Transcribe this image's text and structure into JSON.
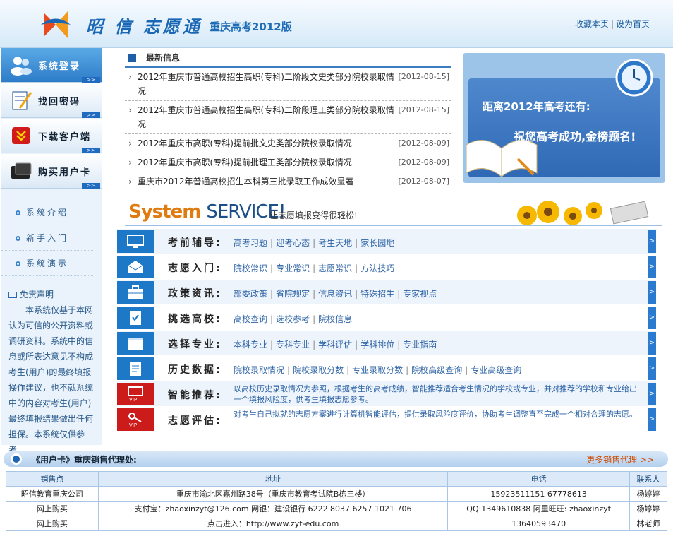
{
  "header": {
    "brand": "昭 信 志愿通",
    "edition": "重庆高考2012版",
    "links": [
      "收藏本页",
      "设为首页"
    ]
  },
  "sidebar": {
    "buttons": [
      {
        "label": "系统登录",
        "icon": "users-icon"
      },
      {
        "label": "找回密码",
        "icon": "notepad-icon"
      },
      {
        "label": "下载客户端",
        "icon": "download-icon"
      },
      {
        "label": "购买用户卡",
        "icon": "card-icon"
      }
    ],
    "subnav": [
      "系统介绍",
      "新手入门",
      "系统演示"
    ],
    "disclaimer_title": "免责声明",
    "disclaimer_text": "本系统仅基于本网认为可信的公开资料或调研资料。系统中的信息或所表达意见不构成考生(用户)的最终填报操作建议，也不就系统中的内容对考生(用户)最终填报结果做出任何担保。本系统仅供参考。"
  },
  "news": {
    "title": "最新信息",
    "items": [
      {
        "text": "2012年重庆市普通高校招生高职(专科)二阶段文史类部分院校录取情况",
        "date": "[2012-08-15]"
      },
      {
        "text": "2012年重庆市普通高校招生高职(专科)二阶段理工类部分院校录取情况",
        "date": "[2012-08-15]"
      },
      {
        "text": "2012年重庆市高职(专科)提前批文史类部分院校录取情况",
        "date": "[2012-08-09]"
      },
      {
        "text": "2012年重庆市高职(专科)提前批理工类部分院校录取情况",
        "date": "[2012-08-09]"
      },
      {
        "text": "重庆市2012年普通高校招生本科第三批录取工作成效显著",
        "date": "[2012-08-07]"
      }
    ]
  },
  "countdown": {
    "line1": "距离2012年高考还有:",
    "line2": "祝您高考成功,金榜题名!"
  },
  "service": {
    "big1": "System",
    "big2": "SERVICE!",
    "subtitle": "让志愿填报变得很轻松!"
  },
  "rows": [
    {
      "name": "考前辅导:",
      "links": [
        "高考习题",
        "迎考心态",
        "考生天地",
        "家长园地"
      ],
      "tile": "blue",
      "icon": "monitor-icon"
    },
    {
      "name": "志愿入门:",
      "links": [
        "院校常识",
        "专业常识",
        "志愿常识",
        "方法技巧"
      ],
      "tile": "blue",
      "icon": "envelope-icon"
    },
    {
      "name": "政策资讯:",
      "links": [
        "部委政策",
        "省院规定",
        "信息资讯",
        "特殊招生",
        "专家视点"
      ],
      "tile": "blue",
      "icon": "briefcase-icon"
    },
    {
      "name": "挑选高校:",
      "links": [
        "高校查询",
        "选校参考",
        "院校信息"
      ],
      "tile": "blue",
      "icon": "clipboard-icon"
    },
    {
      "name": "选择专业:",
      "links": [
        "本科专业",
        "专科专业",
        "学科评估",
        "学科排位",
        "专业指南"
      ],
      "tile": "blue",
      "icon": "calendar-icon"
    },
    {
      "name": "历史数据:",
      "links": [
        "院校录取情况",
        "院校录取分数",
        "专业录取分数",
        "院校高级查询",
        "专业高级查询"
      ],
      "tile": "blue",
      "icon": "document-icon"
    },
    {
      "name": "智能推荐:",
      "desc": "以高校历史录取情况为参照，根据考生的高考成绩，智能推荐适合考生情况的学校或专业，并对推荐的学校和专业给出一个填报风险度，供考生填报志愿参考。",
      "tile": "red",
      "icon": "vip-monitor-icon"
    },
    {
      "name": "志愿评估:",
      "desc": "对考生自己拟就的志愿方案进行计算机智能评估，提供录取风险度评价，协助考生调整直至完成一个相对合理的志愿。",
      "tile": "red",
      "icon": "vip-key-icon"
    }
  ],
  "agents": {
    "title": "《用户卡》重庆销售代理处:",
    "more": "更多销售代理 >>",
    "headers": [
      "销售点",
      "地址",
      "电话",
      "联系人"
    ],
    "rows": [
      [
        "昭信教育重庆公司",
        "重庆市渝北区嘉州路38号（重庆市教育考试院B栋三楼）",
        "15923511151 67778613",
        "杨婷婷"
      ],
      [
        "网上购买",
        "支付宝：zhaoxinzyt@126.com 网银：建设银行 6222 8037 6257 1021 706",
        "QQ:1349610838 阿里旺旺: zhaoxinzyt",
        "杨婷婷"
      ],
      [
        "网上购买",
        "点击进入：http://www.zyt-edu.com",
        "13640593470",
        "林老师"
      ]
    ]
  }
}
